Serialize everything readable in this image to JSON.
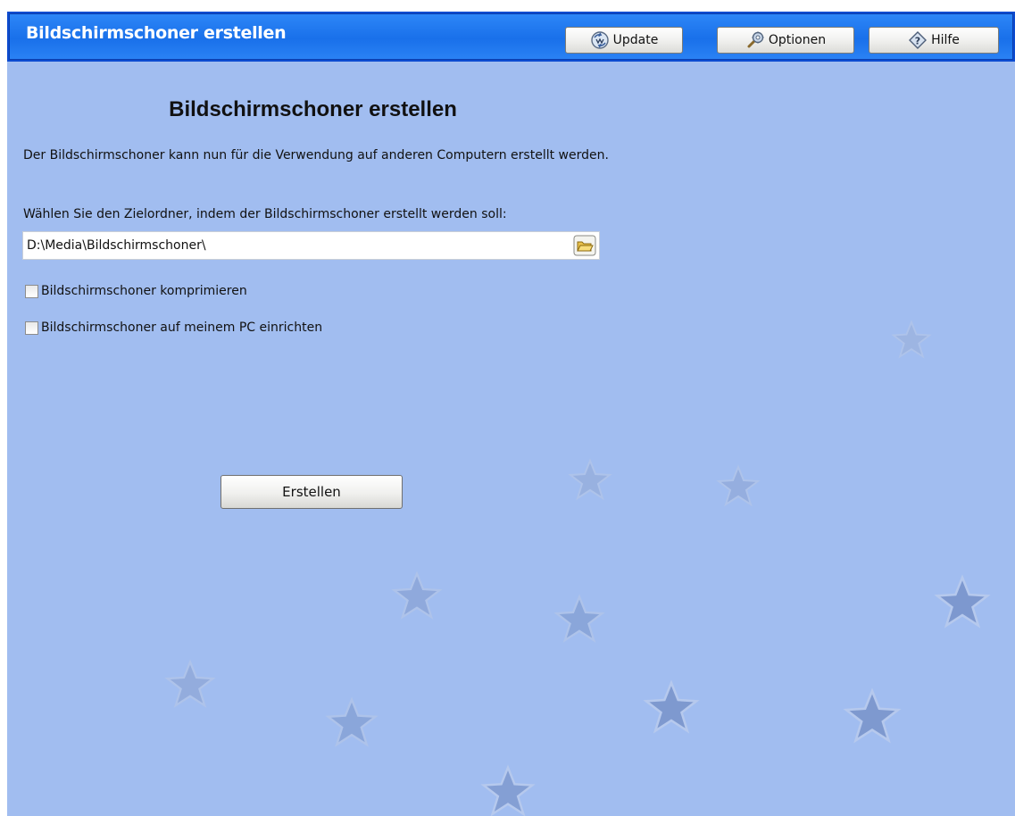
{
  "header": {
    "title": "Bildschirmschoner erstellen",
    "buttons": {
      "update": {
        "label": "Update",
        "icon": "update-icon"
      },
      "options": {
        "label": "Optionen",
        "icon": "options-icon"
      },
      "help": {
        "label": "Hilfe",
        "icon": "help-icon"
      }
    }
  },
  "main": {
    "heading": "Bildschirmschoner erstellen",
    "description": "Der Bildschirmschoner kann nun für die Verwendung auf anderen Computern erstellt werden.",
    "folder_label": "Wählen Sie den Zielordner, indem der Bildschirmschoner erstellt werden soll:",
    "folder_value": "D:\\Media\\Bildschirmschoner\\",
    "browse_icon": "folder-open-icon",
    "checkboxes": [
      {
        "label": "Bildschirmschoner komprimieren",
        "checked": false
      },
      {
        "label": "Bildschirmschoner auf meinem PC einrichten",
        "checked": false
      }
    ],
    "create_button": "Erstellen"
  },
  "colors": {
    "background": "#a1bdf0",
    "header": "#1970ea",
    "header_text": "#ffffff",
    "star": "#6f8fc9"
  }
}
